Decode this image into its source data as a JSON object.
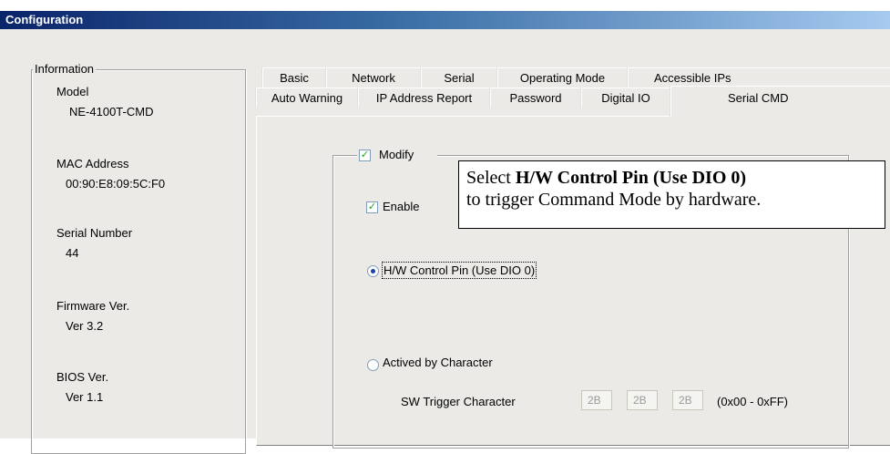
{
  "window": {
    "title": "Configuration"
  },
  "information": {
    "legend": "Information",
    "model_label": "Model",
    "model_value": "NE-4100T-CMD",
    "mac_label": "MAC Address",
    "mac_value": "00:90:E8:09:5C:F0",
    "serial_label": "Serial Number",
    "serial_value": "44",
    "firmware_label": "Firmware Ver.",
    "firmware_value": "Ver 3.2",
    "bios_label": "BIOS Ver.",
    "bios_value": "Ver 1.1"
  },
  "tabs_top": [
    "Basic",
    "Network",
    "Serial",
    "Operating Mode",
    "Accessible IPs"
  ],
  "tabs_bottom": [
    "Auto Warning",
    "IP Address Report",
    "Password",
    "Digital IO",
    "Serial CMD"
  ],
  "selected_tab": "Serial CMD",
  "serial_cmd": {
    "modify_label": "Modify",
    "modify_checked": true,
    "enable_label": "Enable",
    "enable_checked": true,
    "hw_option_label": "H/W Control Pin (Use DIO 0)",
    "hw_option_selected": true,
    "char_option_label": "Actived by Character",
    "char_option_selected": false,
    "sw_trigger_label": "SW Trigger Character",
    "sw_trigger_values": [
      "2B",
      "2B",
      "2B"
    ],
    "sw_trigger_range": "(0x00 - 0xFF)"
  },
  "callout": {
    "line1_prefix": "Select ",
    "line1_bold": "H/W Control Pin (Use DIO 0)",
    "line2": "to trigger Command Mode by hardware."
  },
  "icons": {
    "check": "checkmark-icon",
    "radio": "radio-dot-icon"
  },
  "colors": {
    "title_start": "#0a246a",
    "title_end": "#a6caf0",
    "check": "#21a121",
    "radio_dot": "#1d40b0"
  }
}
